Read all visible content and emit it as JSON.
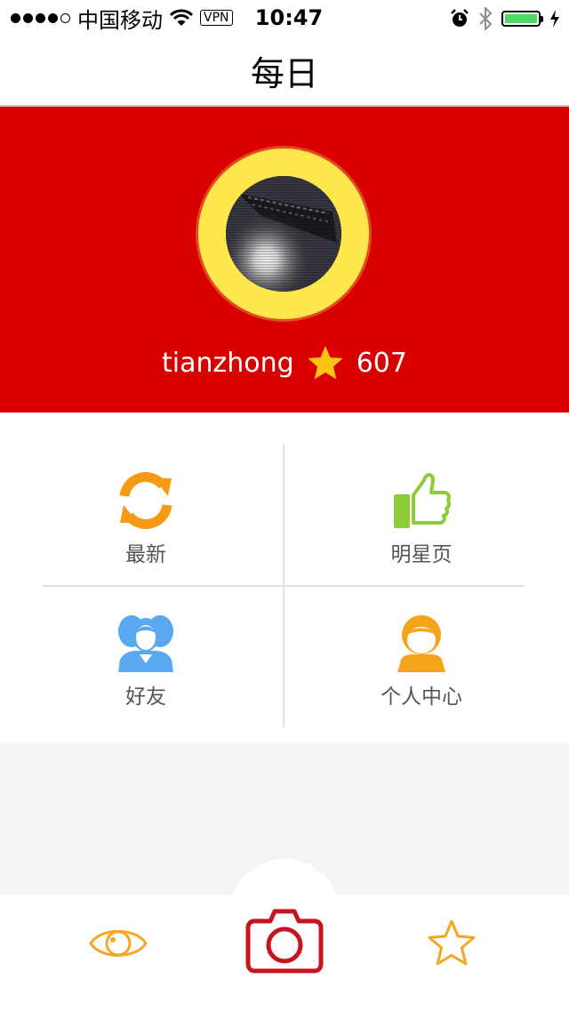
{
  "status_bar": {
    "carrier": "中国移动",
    "vpn": "VPN",
    "time": "10:47",
    "battery_level": 1.0
  },
  "navbar": {
    "title": "每日"
  },
  "profile": {
    "username": "tianzhong",
    "score": "607",
    "colors": {
      "background": "#d90000",
      "ring": "#fde74c",
      "star": "#fdc315"
    }
  },
  "menu": {
    "latest": {
      "label": "最新",
      "icon": "refresh-icon",
      "color": "#f59a15"
    },
    "stars": {
      "label": "明星页",
      "icon": "thumbs-up-icon",
      "color": "#8ccd37"
    },
    "friends": {
      "label": "好友",
      "icon": "friends-icon",
      "color": "#5aa9f0"
    },
    "personal": {
      "label": "个人中心",
      "icon": "person-icon",
      "color": "#f5a31a"
    }
  },
  "tabbar": {
    "left_icon": "eye-icon",
    "center_icon": "camera-icon",
    "right_icon": "star-outline-icon",
    "colors": {
      "accent": "#f5a623",
      "camera": "#c8141c"
    }
  }
}
